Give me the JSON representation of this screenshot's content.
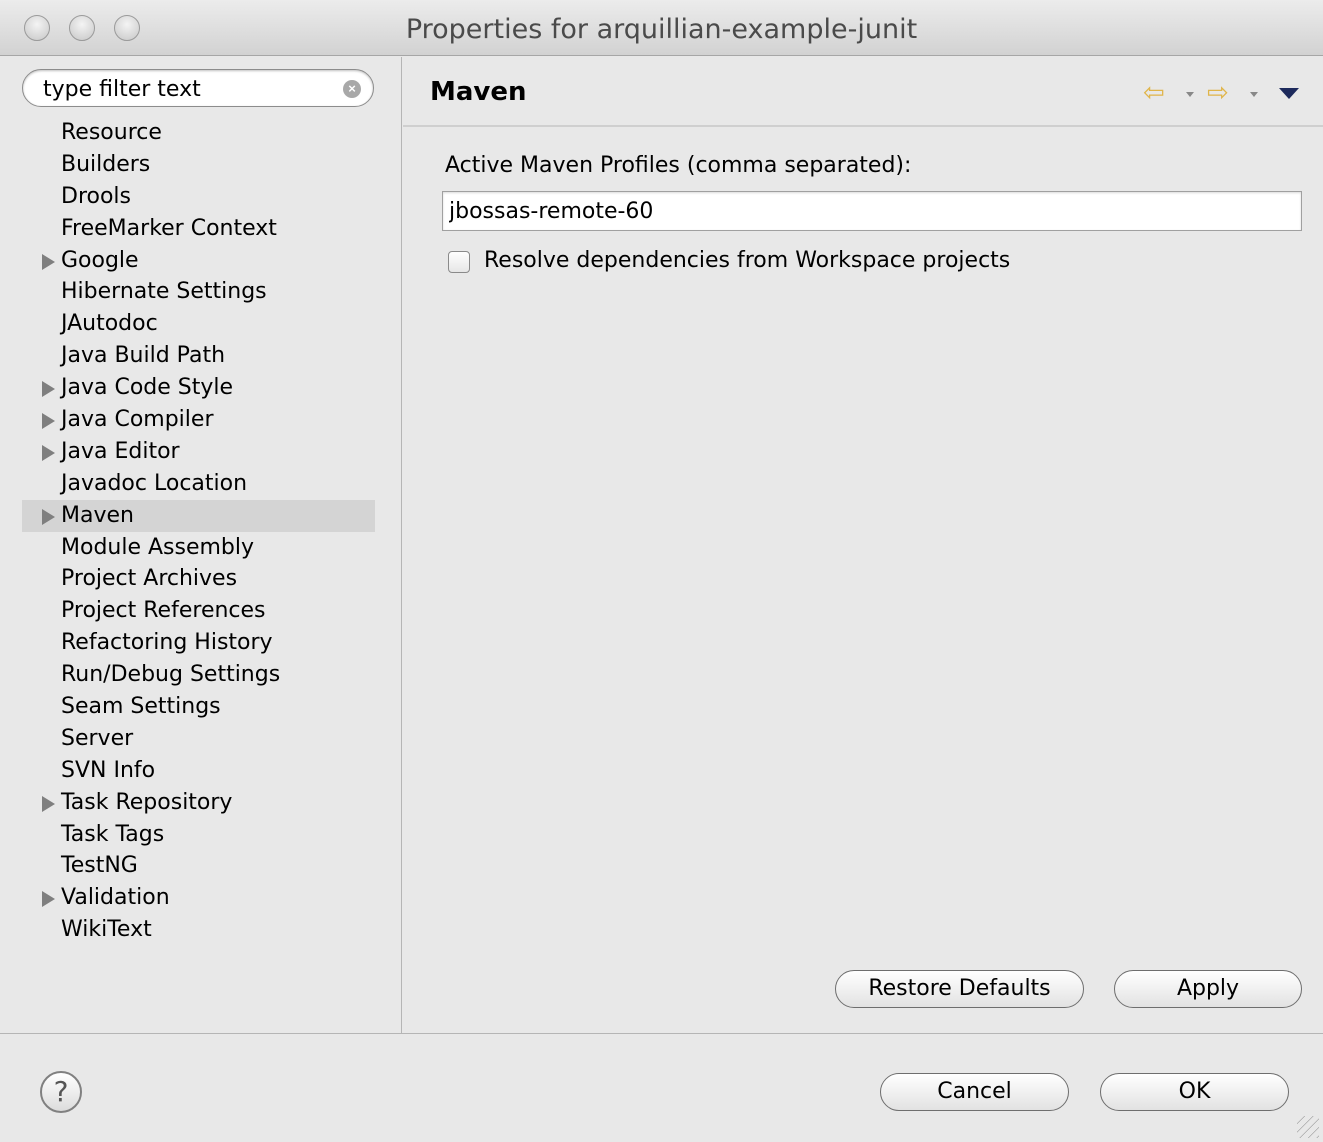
{
  "window": {
    "title": "Properties for arquillian-example-junit"
  },
  "filter": {
    "placeholder": "type filter text"
  },
  "tree": [
    {
      "label": "Resource",
      "expandable": false
    },
    {
      "label": "Builders",
      "expandable": false
    },
    {
      "label": "Drools",
      "expandable": false
    },
    {
      "label": "FreeMarker Context",
      "expandable": false
    },
    {
      "label": "Google",
      "expandable": true
    },
    {
      "label": "Hibernate Settings",
      "expandable": false
    },
    {
      "label": "JAutodoc",
      "expandable": false
    },
    {
      "label": "Java Build Path",
      "expandable": false
    },
    {
      "label": "Java Code Style",
      "expandable": true
    },
    {
      "label": "Java Compiler",
      "expandable": true
    },
    {
      "label": "Java Editor",
      "expandable": true
    },
    {
      "label": "Javadoc Location",
      "expandable": false
    },
    {
      "label": "Maven",
      "expandable": true,
      "selected": true
    },
    {
      "label": "Module Assembly",
      "expandable": false
    },
    {
      "label": "Project Archives",
      "expandable": false
    },
    {
      "label": "Project References",
      "expandable": false
    },
    {
      "label": "Refactoring History",
      "expandable": false
    },
    {
      "label": "Run/Debug Settings",
      "expandable": false
    },
    {
      "label": "Seam Settings",
      "expandable": false
    },
    {
      "label": "Server",
      "expandable": false
    },
    {
      "label": "SVN Info",
      "expandable": false
    },
    {
      "label": "Task Repository",
      "expandable": true
    },
    {
      "label": "Task Tags",
      "expandable": false
    },
    {
      "label": "TestNG",
      "expandable": false
    },
    {
      "label": "Validation",
      "expandable": true
    },
    {
      "label": "WikiText",
      "expandable": false
    }
  ],
  "page": {
    "title": "Maven",
    "profiles_label": "Active Maven Profiles (comma separated):",
    "profiles_value": "jbossas-remote-60",
    "resolve_label": "Resolve dependencies from Workspace projects",
    "resolve_checked": false,
    "restore_label": "Restore Defaults",
    "apply_label": "Apply"
  },
  "nav": {
    "back_icon": "back-arrow-icon",
    "forward_icon": "forward-arrow-icon",
    "menu_icon": "view-menu-icon"
  },
  "footer": {
    "cancel_label": "Cancel",
    "ok_label": "OK",
    "help_icon": "help-icon"
  },
  "colors": {
    "selection": "#d4d4d4",
    "nav_arrow": "#e0b54a",
    "menu_triangle": "#1d2a5c"
  }
}
